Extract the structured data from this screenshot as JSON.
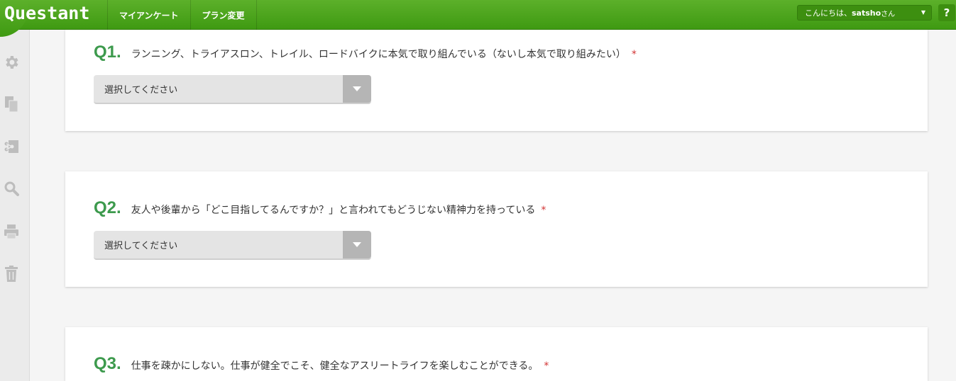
{
  "header": {
    "logo": "Questant",
    "nav": [
      "マイアンケート",
      "プラン変更"
    ],
    "user_greeting_prefix": "こんにちは、",
    "user_name": "satsho",
    "user_suffix": "さん",
    "help_label": "?"
  },
  "sidebar": {
    "icons": [
      "gear-icon",
      "copy-icon",
      "share-icon",
      "search-icon",
      "print-icon",
      "trash-icon"
    ]
  },
  "questions": [
    {
      "number": "Q1.",
      "text": "ランニング、トライアスロン、トレイル、ロードバイクに本気で取り組んでいる（ないし本気で取り組みたい）",
      "required_mark": "*",
      "select_placeholder": "選択してください"
    },
    {
      "number": "Q2.",
      "text": "友人や後輩から「どこ目指してるんですか？」と言われてもどうじない精神力を持っている",
      "required_mark": "*",
      "select_placeholder": "選択してください"
    },
    {
      "number": "Q3.",
      "text": "仕事を疎かにしない。仕事が健全でこそ、健全なアスリートライフを楽しむことができる。",
      "required_mark": "*"
    }
  ],
  "colors": {
    "brand_green": "#4aa31c",
    "question_number": "#3d9a4d",
    "required": "#d23333"
  }
}
